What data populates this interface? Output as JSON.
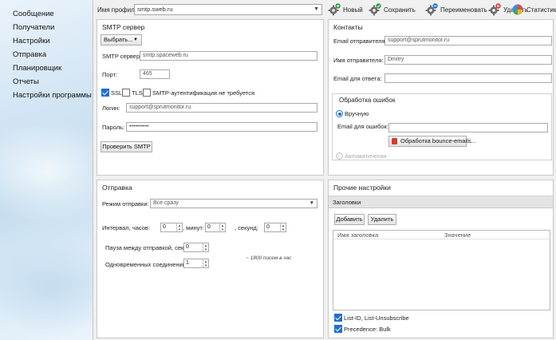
{
  "sidebar": {
    "items": [
      {
        "label": "Сообщение"
      },
      {
        "label": "Получатели"
      },
      {
        "label": "Настройки"
      },
      {
        "label": "Отправка"
      },
      {
        "label": "Планировщик"
      },
      {
        "label": "Отчеты"
      },
      {
        "label": "Настройки программы"
      }
    ]
  },
  "toolbar": {
    "profile_label": "Имя профиля:",
    "profile_value": "smtp.sweb.ru",
    "new_label": "Новый",
    "save_label": "Сохранить",
    "rename_label": "Переименовать",
    "delete_label": "Удалить",
    "stats_label": "Статистика"
  },
  "smtp": {
    "title": "SMTP сервер",
    "choose_label": "Выбрать...",
    "server_label": "SMTP сервер:",
    "server_value": "smtp.spaceweb.ru",
    "port_label": "Порт:",
    "port_value": "465",
    "ssl_label": "SSL",
    "ssl_checked": true,
    "tls_label": "TLS",
    "tls_checked": false,
    "noauth_label": "SMTP-аутентификация не требуется",
    "noauth_checked": false,
    "login_label": "Логин:",
    "login_value": "support@sprutmonitor.ru",
    "password_label": "Пароль:",
    "password_value": "••••••••••",
    "check_label": "Проверить SMTP"
  },
  "contacts": {
    "title": "Контакты",
    "sender_email_label": "Email отправителя:",
    "sender_email_value": "support@sprutmonitor.ru",
    "sender_name_label": "Имя отправителя:",
    "sender_name_value": "Dmitry",
    "reply_label": "Email для ответа:",
    "reply_value": ""
  },
  "errors": {
    "title": "Обработка ошибок",
    "manual_label": "Вручную",
    "errors_email_label": "Email для ошибок:",
    "errors_email_value": "",
    "bounce_label": "Обработка bounce-emails...",
    "auto_label": "Автоматически"
  },
  "sending": {
    "title": "Отправка",
    "mode_label": "Режим отправки:",
    "mode_value": "Все сразу",
    "interval_label": "Интервал, часов:",
    "hours_value": "0",
    "minutes_label": ", минут:",
    "minutes_value": "0",
    "seconds_label": ", секунд:",
    "seconds_value": "0",
    "pause_label": "Пауза между отправкой, сек:",
    "pause_value": "0",
    "rate_note": "~ 1800 писем в час",
    "connections_label": "Одновременных соединений:",
    "connections_value": "1"
  },
  "other": {
    "title": "Прочие настройки",
    "tab_headers": "Заголовки",
    "add_label": "Добавить",
    "remove_label": "Удалить",
    "col_name": "Имя заголовка",
    "col_value": "Значение",
    "listid_label": "List-ID, List-Unsubscribe",
    "listid_checked": true,
    "precedence_label": "Precedence: Bulk",
    "precedence_checked": true
  },
  "colors": {
    "accent": "#1e6fd0",
    "sidebar_bg": "#d4e6f5"
  }
}
